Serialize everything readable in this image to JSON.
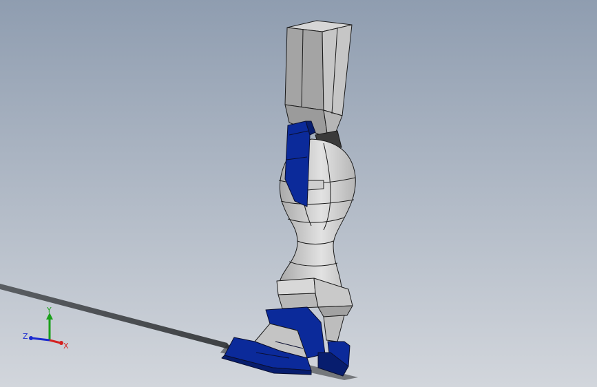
{
  "colors": {
    "background_top": "#8f9db0",
    "background_bottom": "#d2d6dc",
    "part_gray": "#bdbdbd",
    "part_gray_light": "#dcdcdc",
    "part_gray_dark": "#8a8a8a",
    "part_blue": "#0b2a9a",
    "part_blue_dark": "#071d6e",
    "edge": "#1a1a1a",
    "axis_x": "#d42020",
    "axis_y": "#1aa01a",
    "axis_z": "#1a2ad0"
  },
  "triad": {
    "x_label": "X",
    "y_label": "Y",
    "z_label": "Z"
  }
}
